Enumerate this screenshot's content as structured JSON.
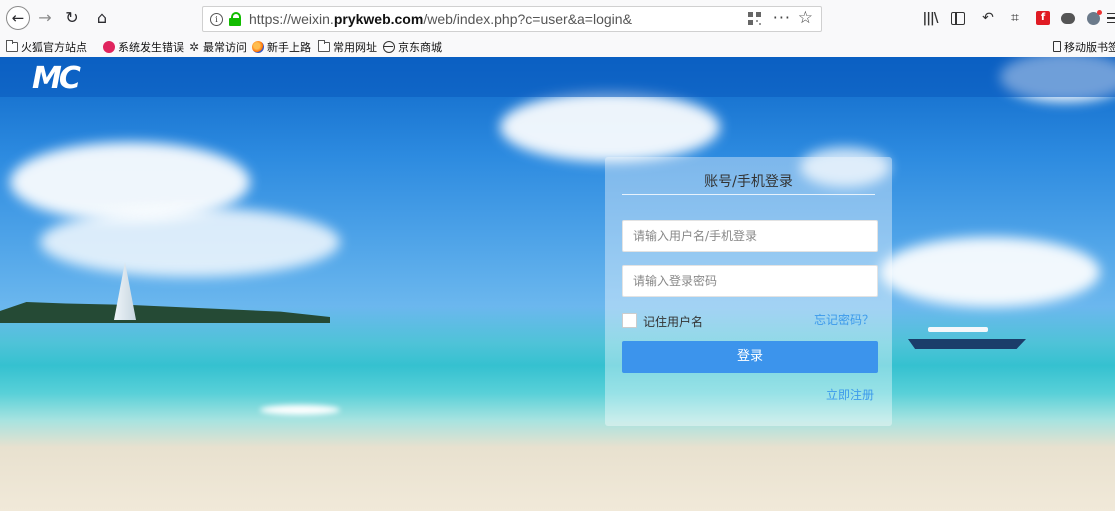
{
  "browser": {
    "url_prefix": "https://weixin.",
    "url_domain": "prykweb.com",
    "url_path": "/web/index.php?c=user&a=login&",
    "more_label": "···",
    "library_label": "|||\\"
  },
  "bookmarks": [
    {
      "label": "火狐官方站点",
      "icon": "folder-icon"
    },
    {
      "label": "系统发生错误",
      "icon": "weibo-icon"
    },
    {
      "label": "最常访问",
      "icon": "gear-icon"
    },
    {
      "label": "新手上路",
      "icon": "firefox-icon"
    },
    {
      "label": "常用网址",
      "icon": "folder-icon"
    },
    {
      "label": "京东商城",
      "icon": "globe-icon"
    },
    {
      "label": "移动版书签",
      "icon": "mobile-icon"
    }
  ],
  "site": {
    "logo": "MC"
  },
  "login": {
    "title": "账号/手机登录",
    "username_placeholder": "请输入用户名/手机登录",
    "password_placeholder": "请输入登录密码",
    "remember_label": "记住用户名",
    "forgot_label": "忘记密码？",
    "login_button": "登录",
    "register_label": "立即注册"
  },
  "colors": {
    "accent": "#3c94ec",
    "link": "#3c9aeb",
    "header": "#0d67c8"
  }
}
